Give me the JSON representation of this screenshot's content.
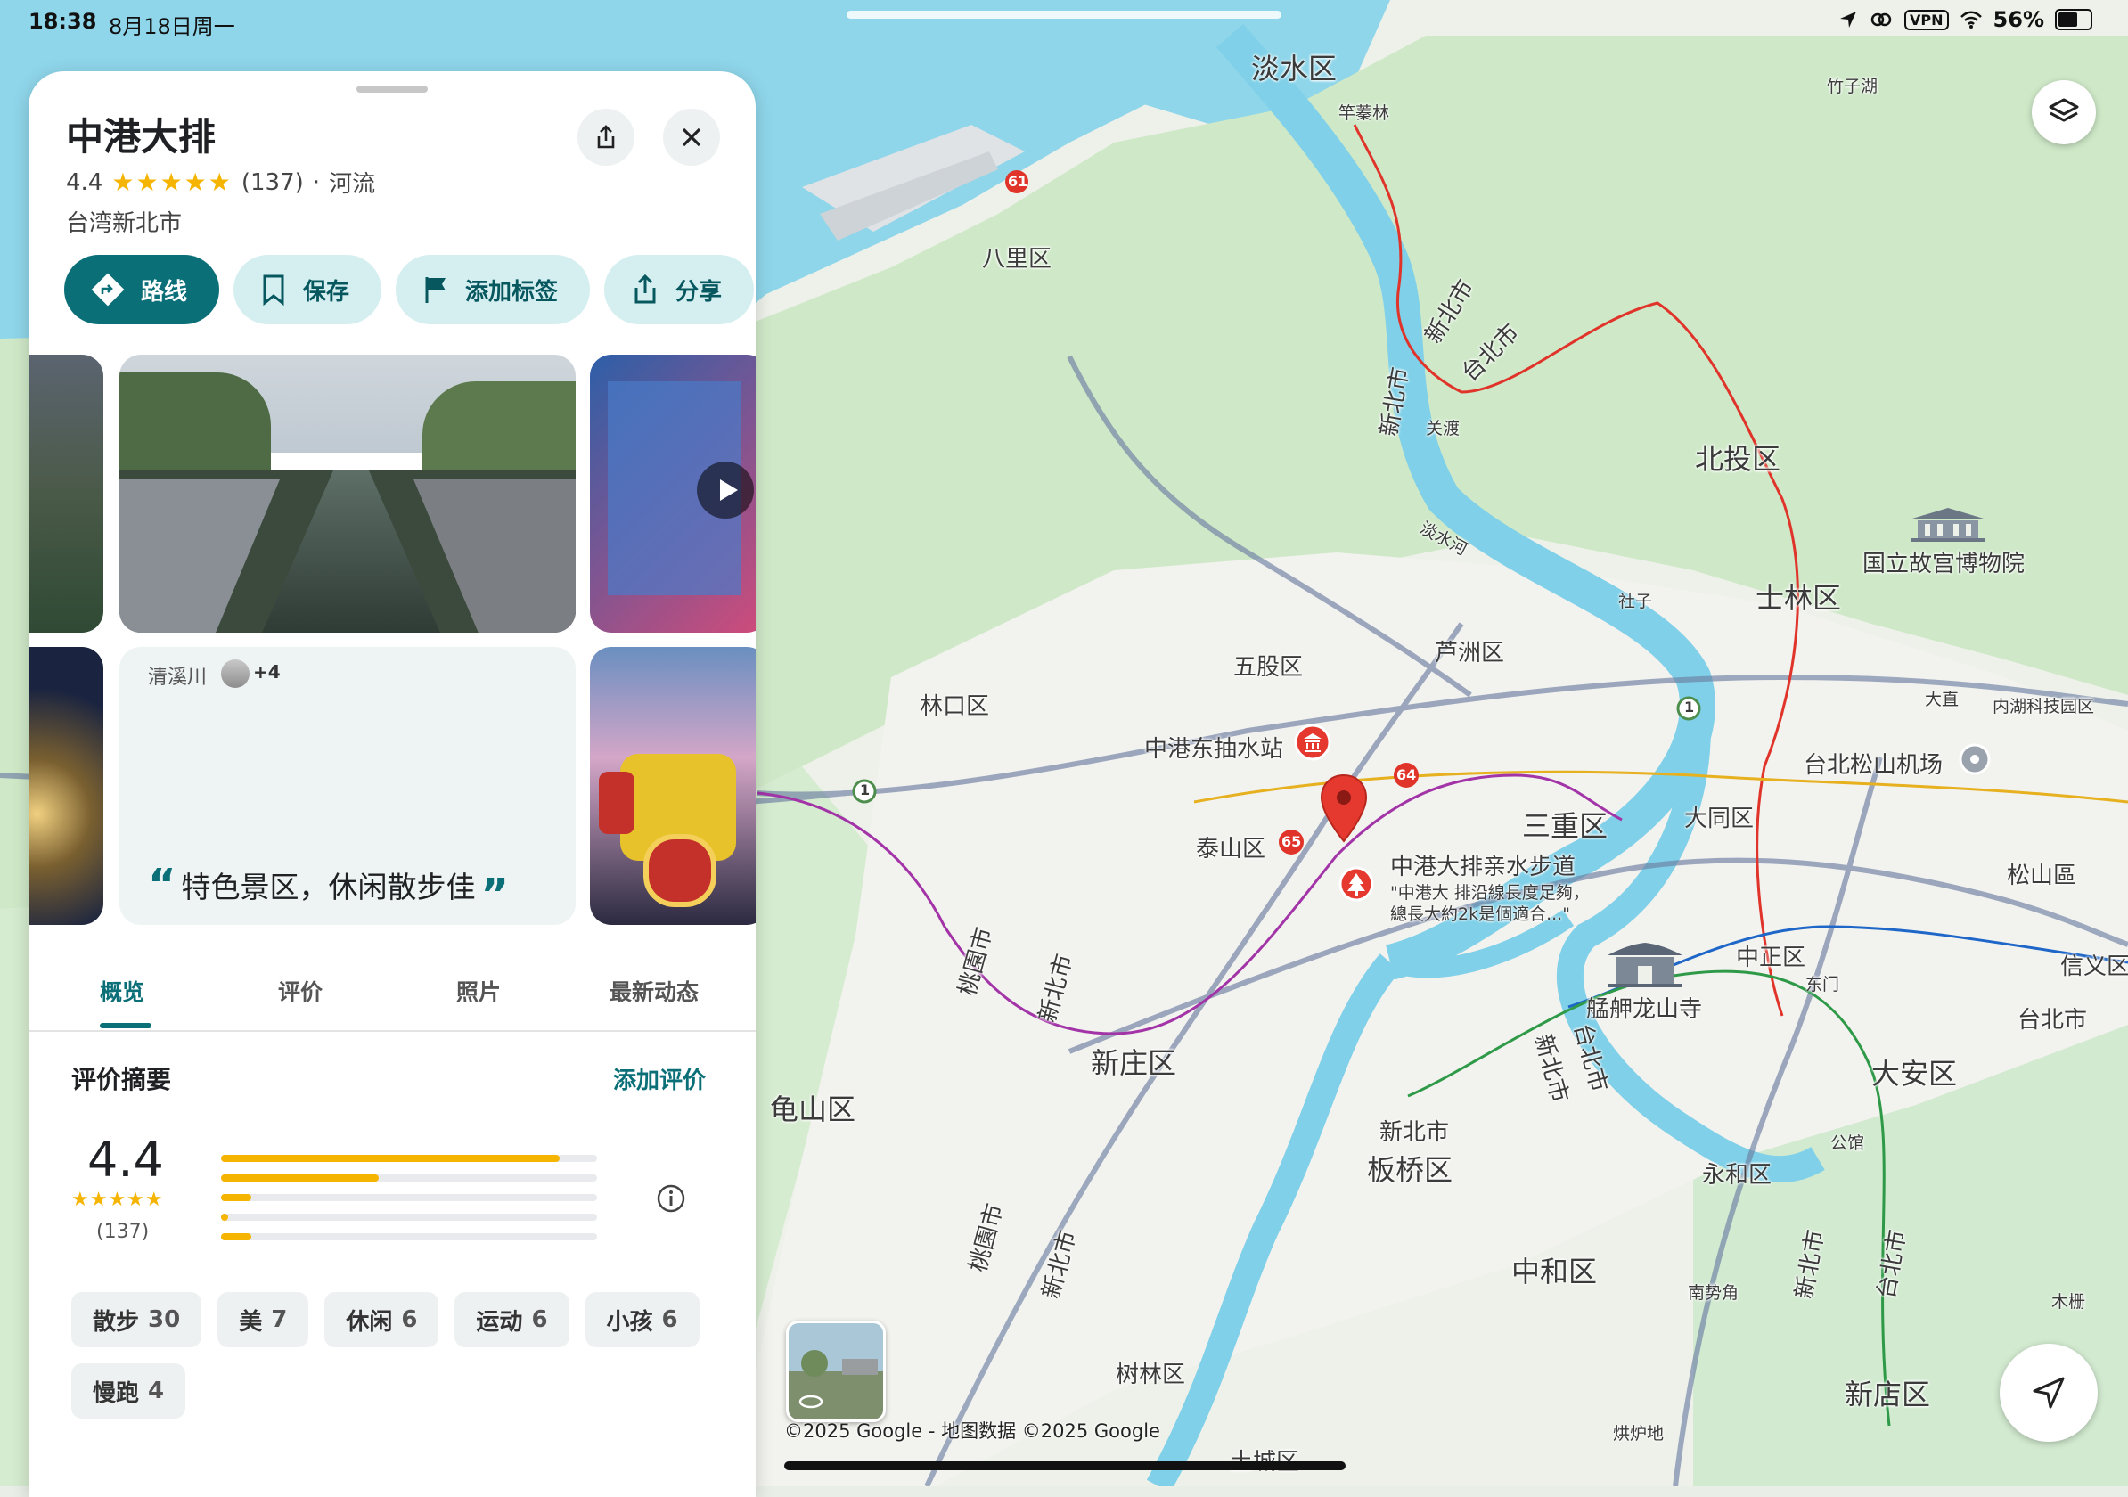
{
  "status_bar": {
    "time": "18:38",
    "date": "8月18日周一",
    "vpn": "VPN",
    "battery": "56%"
  },
  "panel": {
    "title": "中港大排",
    "rating": "4.4",
    "review_count": "(137)",
    "separator": "·",
    "category": "河流",
    "location": "台湾新北市",
    "share_icon": "share-icon",
    "close_icon": "close-icon"
  },
  "actions": [
    {
      "label": "路线",
      "icon": "directions-icon"
    },
    {
      "label": "保存",
      "icon": "bookmark-icon"
    },
    {
      "label": "添加标签",
      "icon": "flag-icon"
    },
    {
      "label": "分享",
      "icon": "share-icon"
    }
  ],
  "review_card": {
    "author": "清溪川",
    "more": "+4",
    "quote": "特色景区，休闲散步佳"
  },
  "tabs": [
    "概览",
    "评价",
    "照片",
    "最新动态"
  ],
  "summary": {
    "title": "评价摘要",
    "add_review": "添加评价",
    "rating": "4.4",
    "count": "(137)",
    "distribution": [
      0.9,
      0.42,
      0.08,
      0.02,
      0.08
    ],
    "info_icon": "info-icon"
  },
  "tags": [
    {
      "label": "散步",
      "count": "30"
    },
    {
      "label": "美",
      "count": "7"
    },
    {
      "label": "休闲",
      "count": "6"
    },
    {
      "label": "运动",
      "count": "6"
    },
    {
      "label": "小孩",
      "count": "6"
    },
    {
      "label": "慢跑",
      "count": "4"
    }
  ],
  "map": {
    "labels": {
      "danshui": "淡水区",
      "zhuoweilin": "竿蓁林",
      "zhuzihu": "竹子湖",
      "bali": "八里区",
      "xinbei1": "新北市",
      "taibei1": "台北市",
      "xinbei2": "新北市",
      "guandu": "关渡",
      "beitou": "北投区",
      "danshuihe": "淡水河",
      "palace_museum": "国立故宫博物院",
      "shizi": "社子",
      "shilin": "士林区",
      "wugu": "五股区",
      "luzhou": "芦洲区",
      "linkou": "林口区",
      "dazhi": "大直",
      "neihu": "内湖科技园区",
      "songshan_airport": "台北松山机场",
      "pump_station": "中港东抽水站",
      "sanchong": "三重区",
      "datong": "大同区",
      "songshan": "松山區",
      "taishan": "泰山区",
      "walkway": "中港大排亲水步道",
      "walkway_review": "\"中港大 排沿線長度足夠，總長大約2k是個適合...\"",
      "zhongzheng": "中正区",
      "xinyi": "信义区",
      "dongmen": "东门",
      "taibei2": "台北市",
      "taoyuan1": "桃園市",
      "xinbei3": "新北市",
      "mengjia": "艋舺龙山寺",
      "xinbei4": "新北市",
      "taibei3": "台北市",
      "xinzhuang": "新庄区",
      "guishan": "龟山区",
      "daan": "大安区",
      "xinbei5": "新北市",
      "banqiao": "板桥区",
      "yonghe": "永和区",
      "gongguan": "公馆",
      "zhonghe": "中和区",
      "nanshijiao": "南势角",
      "taoyuan2": "桃園市",
      "xinbei6": "新北市",
      "xinbei7": "新北市",
      "taibei4": "台北市",
      "mucha": "木栅",
      "shulin": "树林区",
      "xindian": "新店区",
      "tucheng": "土城区",
      "hongluodi": "烘炉地",
      "r61": "61",
      "r64": "64",
      "r65": "65",
      "r1a": "1",
      "r1b": "1"
    },
    "credit": "©2025 Google - 地图数据 ©2025 Google",
    "layers_icon": "layers-icon",
    "locate_icon": "navigation-arrow-icon"
  }
}
